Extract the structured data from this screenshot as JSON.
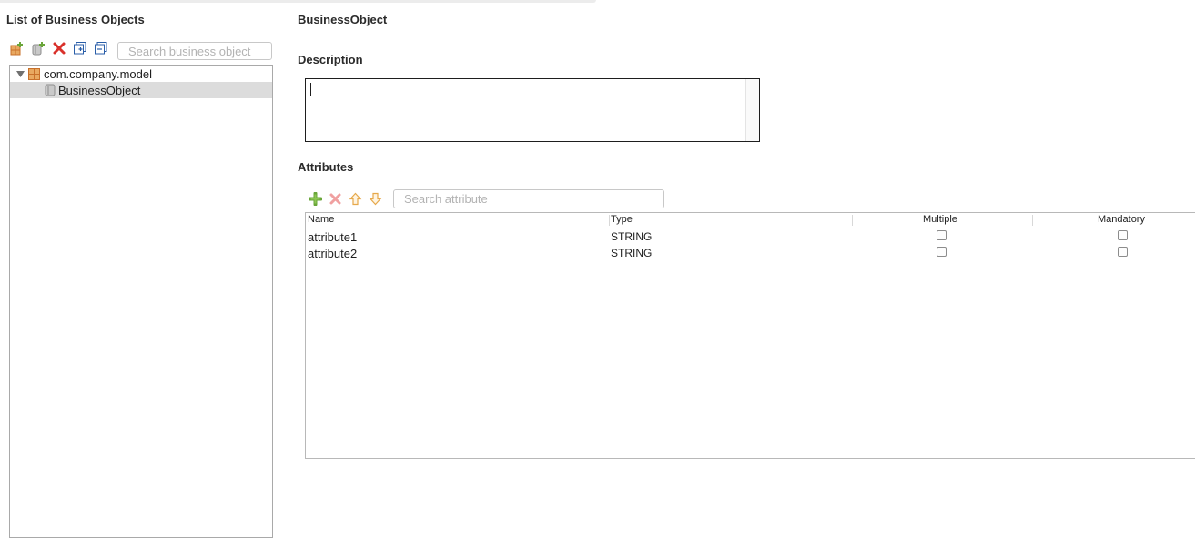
{
  "left_panel": {
    "title": "List of Business Objects",
    "search_placeholder": "Search business object",
    "toolbar": [
      {
        "icon": "add-package-icon"
      },
      {
        "icon": "add-business-object-icon"
      },
      {
        "icon": "delete-icon"
      },
      {
        "icon": "expand-all-icon"
      },
      {
        "icon": "collapse-all-icon"
      }
    ],
    "tree": {
      "package": "com.company.model",
      "children": [
        {
          "label": "BusinessObject",
          "selected": true
        }
      ]
    }
  },
  "detail": {
    "title": "BusinessObject",
    "description_label": "Description",
    "description_value": "",
    "attributes_label": "Attributes",
    "attribute_search_placeholder": "Search attribute",
    "attribute_toolbar": [
      {
        "icon": "add-attribute-icon"
      },
      {
        "icon": "remove-attribute-icon"
      },
      {
        "icon": "move-up-icon"
      },
      {
        "icon": "move-down-icon"
      }
    ],
    "columns": [
      "Name",
      "Type",
      "Multiple",
      "Mandatory"
    ],
    "rows": [
      {
        "name": "attribute1",
        "type": "STRING",
        "multiple": false,
        "mandatory": false
      },
      {
        "name": "attribute2",
        "type": "STRING",
        "multiple": false,
        "mandatory": false
      }
    ]
  },
  "colors": {
    "selection": "#dcdcdc",
    "add_green": "#6aa63a",
    "delete_red": "#d9312b",
    "arrow_orange": "#e6a84a",
    "package_orange": "#c8702a"
  }
}
